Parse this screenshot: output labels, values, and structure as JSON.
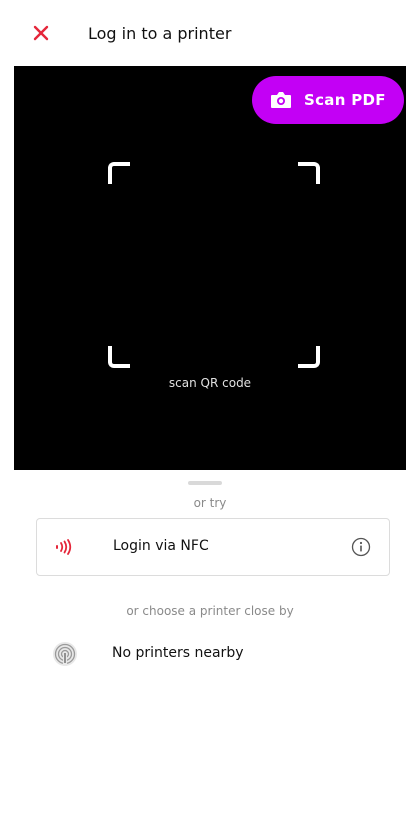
{
  "header": {
    "title": "Log in to a printer",
    "close_icon": "close-icon"
  },
  "scanner": {
    "scan_pdf_label": "Scan PDF",
    "scan_hint": "scan QR code"
  },
  "sheet": {
    "or_try": "or try",
    "nfc_label": "Login via NFC",
    "choose_label": "or choose a printer close by",
    "nearby_status": "No printers nearby"
  },
  "colors": {
    "accent": "#c300f5",
    "close_red": "#e5263a",
    "nfc_red": "#e5263a"
  }
}
